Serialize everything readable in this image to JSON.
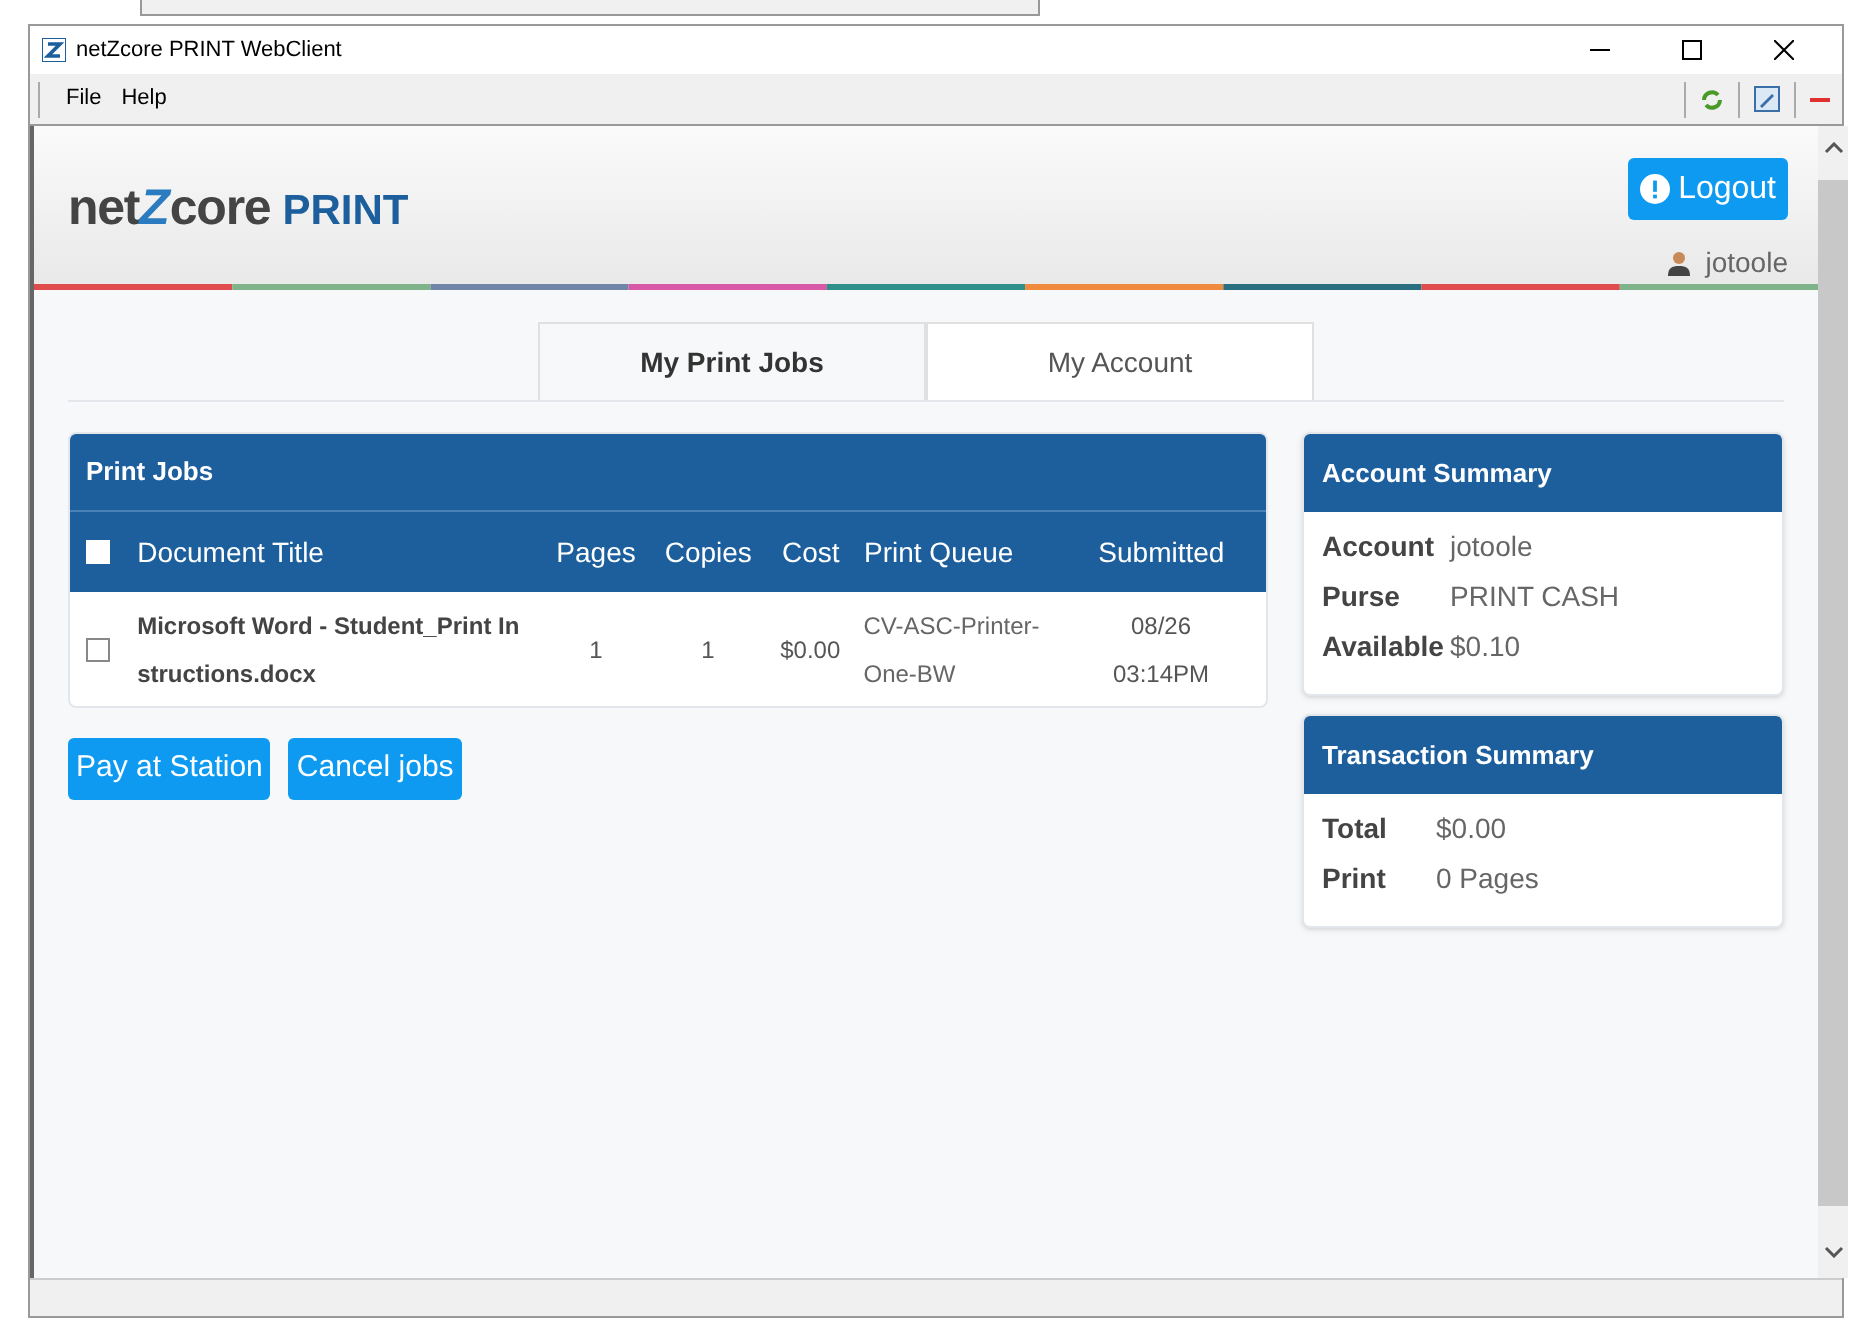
{
  "window": {
    "title": "netZcore PRINT WebClient"
  },
  "menu": [
    "File",
    "Help"
  ],
  "logo": {
    "prefix": "net",
    "mark": "Z",
    "suffix": "core",
    "product": "PRINT"
  },
  "logout": "Logout",
  "user": "jotoole",
  "tabs": [
    {
      "label": "My Print Jobs",
      "selected": true
    },
    {
      "label": "My Account",
      "selected": false
    }
  ],
  "print_jobs": {
    "title": "Print Jobs",
    "select_all": {
      "checked": false
    },
    "columns": [
      "Document Title",
      "Pages",
      "Copies",
      "Cost",
      "Print Queue",
      "Submitted"
    ],
    "rows": [
      {
        "checked": false,
        "cells": [
          "Microsoft Word - Student_Print Instructions.docx",
          "1",
          "1",
          "$0.00",
          "CV-ASC-Printer-One-BW",
          "08/26 03:14PM"
        ]
      }
    ]
  },
  "buttons": [
    "Pay at Station",
    "Cancel jobs"
  ],
  "account_summary": {
    "title": "Account Summary",
    "rows": [
      {
        "label": "Account",
        "value": "jotoole"
      },
      {
        "label": "Purse",
        "value": "PRINT CASH"
      },
      {
        "label": "Available",
        "value": "$0.10"
      }
    ]
  },
  "transaction_summary": {
    "title": "Transaction Summary",
    "rows": [
      {
        "label": "Total",
        "value": "$0.00"
      },
      {
        "label": "Print",
        "value": "0 Pages"
      }
    ]
  }
}
